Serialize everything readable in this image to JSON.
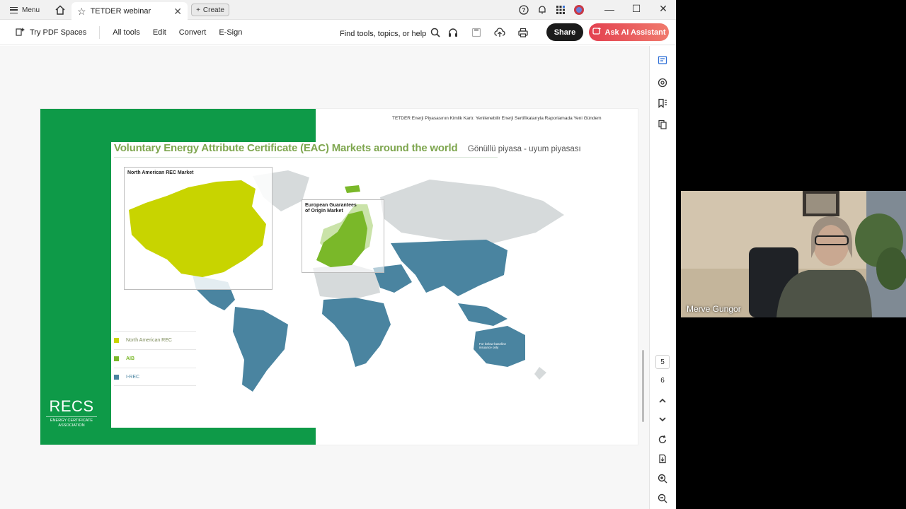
{
  "tabbar": {
    "menu_label": "Menu",
    "tab_title": "TETDER webinar",
    "create_label": "Create"
  },
  "toolbar": {
    "try_spaces": "Try PDF Spaces",
    "items": [
      "All tools",
      "Edit",
      "Convert",
      "E-Sign"
    ],
    "find_placeholder": "Find tools, topics, or help",
    "share_label": "Share",
    "ai_label": "Ask AI Assistant"
  },
  "slide": {
    "header": "TETDER Enerji Piyasasının Kimlik Kartı: Yenilenebilir Enerji Sertifikalarıyla Raporlamada Yeni Gündem",
    "title": "Voluntary Energy Attribute Certificate (EAC) Markets around the world",
    "subtitle": "Gönüllü piyasa - uyum piyasası",
    "north_america_inset": "North American REC Market",
    "europe_inset_line1": "European Guarantees",
    "europe_inset_line2": "of Origin Market",
    "australia_note": "For below-baseline issuance only",
    "legend": [
      {
        "label": "North American REC",
        "color": "#c8d400"
      },
      {
        "label": "AIB",
        "color": "#7ab829"
      },
      {
        "label": "I-REC",
        "color": "#4a84a0"
      }
    ],
    "recs_logo": "RECS",
    "recs_sub1": "ENERGY CERTIFICATE",
    "recs_sub2": "ASSOCIATION"
  },
  "rail": {
    "page_current": "5",
    "page_next": "6"
  },
  "video": {
    "participant_name": "Merve Gungor"
  },
  "colors": {
    "slide_green": "#0e9a48",
    "na_market": "#c8d400",
    "eu_market": "#7ab829",
    "irec_market": "#4a84a0",
    "other_land": "#d6dadb",
    "ai_button": "#e3404f"
  }
}
